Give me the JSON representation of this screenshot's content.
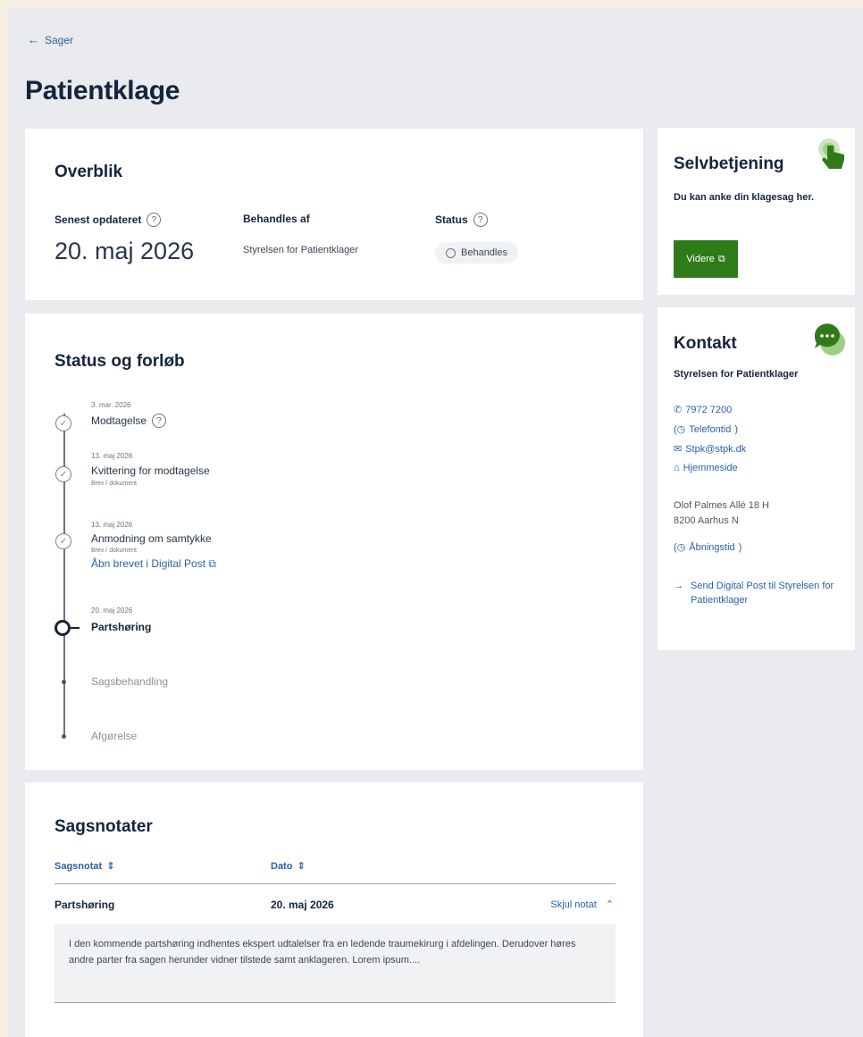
{
  "nav": {
    "back_label": "Sager"
  },
  "page": {
    "title": "Patientklage"
  },
  "overview": {
    "heading": "Overblik",
    "updated_label": "Senest opdateret",
    "updated_value": "20. maj 2026",
    "handled_label": "Behandles af",
    "handled_value": "Styrelsen for Patientklager",
    "status_label": "Status",
    "status_value": "Behandles"
  },
  "timeline": {
    "heading": "Status og forløb",
    "steps": [
      {
        "date": "3. mar. 2026",
        "label": "Modtagelse",
        "state": "done"
      },
      {
        "date": "13. maj 2026",
        "label": "Kvittering for modtagelse",
        "sub": "Brev / dokument",
        "state": "done"
      },
      {
        "date": "13. maj 2026",
        "label": "Anmodning om samtykke",
        "sub": "Brev / dokument",
        "link": "Åbn brevet i Digital Post",
        "state": "done"
      },
      {
        "date": "20. maj 2026",
        "label": "Partshøring",
        "state": "current"
      },
      {
        "label": "Sagsbehandling",
        "state": "future"
      },
      {
        "label": "Afgørelse",
        "state": "future"
      }
    ]
  },
  "notes": {
    "heading": "Sagsnotater",
    "col_note": "Sagsnotat",
    "col_date": "Dato",
    "rows": [
      {
        "title": "Partshøring",
        "date": "20. maj 2026",
        "toggle": "Skjul notat",
        "body": "I den kommende partshøring indhentes ekspert udtalelser fra en ledende traumekirurg i afdelingen. Derudover høres andre parter fra sagen herunder vidner tilstede samt anklageren. Lorem ipsum...."
      }
    ]
  },
  "selfservice": {
    "heading": "Selvbetjening",
    "description": "Du kan anke din klagesag her.",
    "button_label": "Videre"
  },
  "contact": {
    "heading": "Kontakt",
    "org": "Styrelsen for Patientklager",
    "phone": "7972 7200",
    "phone_hours": "Telefontid",
    "email": "Stpk@stpk.dk",
    "website": "Hjemmeside",
    "address_line1": "Olof Palmes Allé 18 H",
    "address_line2": "8200 Aarhus N",
    "opening_hours": "Åbningstid",
    "send_post": "Send Digital Post til Styrelsen for Patientklager"
  },
  "colors": {
    "primary_button": "#2f7b1a",
    "link": "#2a5fa8",
    "heading": "#13253d",
    "page_bg": "#e9ebee"
  }
}
